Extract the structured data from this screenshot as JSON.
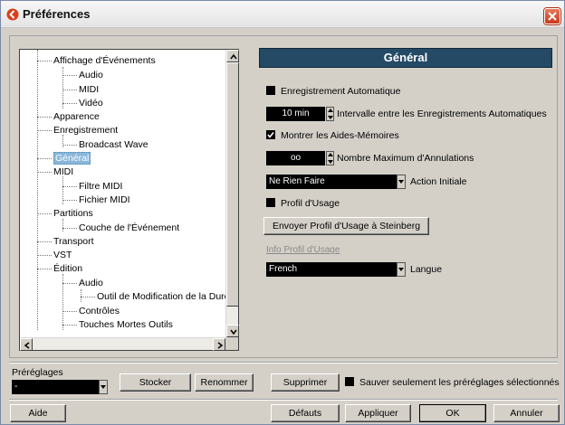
{
  "window": {
    "title": "Préférences"
  },
  "tree": {
    "items": [
      {
        "label": "Affichage d'Événements"
      },
      {
        "label": "Audio"
      },
      {
        "label": "MIDI"
      },
      {
        "label": "Vidéo"
      },
      {
        "label": "Apparence"
      },
      {
        "label": "Enregistrement"
      },
      {
        "label": "Broadcast Wave"
      },
      {
        "label": "Général",
        "selected": true
      },
      {
        "label": "MIDI"
      },
      {
        "label": "Filtre MIDI"
      },
      {
        "label": "Fichier MIDI"
      },
      {
        "label": "Partitions"
      },
      {
        "label": "Couche de l'Événement"
      },
      {
        "label": "Transport"
      },
      {
        "label": "VST"
      },
      {
        "label": "Édition"
      },
      {
        "label": "Audio"
      },
      {
        "label": "Outil de Modification de la Durée"
      },
      {
        "label": "Contrôles"
      },
      {
        "label": "Touches Mortes Outils"
      }
    ]
  },
  "general": {
    "heading": "Général",
    "auto_save_label": "Enregistrement Automatique",
    "interval_value": "10 min",
    "interval_label": "Intervalle entre les Enregistrements Automatiques",
    "show_tips_label": "Montrer les Aides-Mémoires",
    "show_tips_checked": true,
    "max_undo_value": "oo",
    "max_undo_label": "Nombre Maximum d'Annulations",
    "initial_action_value": "Ne Rien Faire",
    "initial_action_label": "Action Initiale",
    "usage_profile_label": "Profil d'Usage",
    "send_profile_button": "Envoyer Profil d'Usage à Steinberg",
    "profile_info_link": "Info Profil d'Usage",
    "language_value": "French",
    "language_label": "Langue"
  },
  "presets": {
    "label": "Préréglages",
    "selected": "-",
    "store_button": "Stocker",
    "rename_button": "Renommer",
    "delete_button": "Supprimer",
    "save_selected_label": "Sauver seulement les préréglages sélectionnés"
  },
  "footer": {
    "help_button": "Aide",
    "defaults_button": "Défauts",
    "apply_button": "Appliquer",
    "ok_button": "OK",
    "cancel_button": "Annuler"
  },
  "colors": {
    "panel_header": "#244a66",
    "selection": "#8ab6d8",
    "close_button": "#d8532f"
  }
}
